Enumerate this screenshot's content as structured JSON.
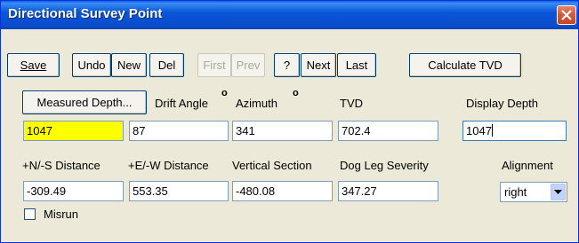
{
  "window": {
    "title": "Directional Survey Point"
  },
  "toolbar": {
    "save_label": "Save",
    "undo_label": "Undo",
    "new_label": "New",
    "del_label": "Del",
    "first_label": "First",
    "prev_label": "Prev",
    "help_label": "?",
    "next_label": "Next",
    "last_label": "Last",
    "calculate_tvd_label": "Calculate TVD"
  },
  "row1": {
    "measured_depth_button": "Measured Depth...",
    "drift_angle_label": "Drift Angle",
    "drift_angle_unit": "o",
    "azimuth_label": "Azimuth",
    "azimuth_unit": "o",
    "tvd_label": "TVD",
    "display_depth_label": "Display Depth",
    "measured_depth_value": "1047",
    "drift_angle_value": "87",
    "azimuth_value": "341",
    "tvd_value": "702.4",
    "display_depth_value": "1047"
  },
  "row2": {
    "ns_distance_label": "+N/-S Distance",
    "ew_distance_label": "+E/-W Distance",
    "vertical_section_label": "Vertical Section",
    "dog_leg_label": "Dog Leg Severity",
    "alignment_label": "Alignment",
    "ns_distance_value": "-309.49",
    "ew_distance_value": "553.35",
    "vertical_section_value": "-480.08",
    "dog_leg_value": "347.27",
    "alignment_value": "right"
  },
  "misrun": {
    "label": "Misrun",
    "checked": false
  },
  "colors": {
    "titlebar": "#0a4ccc",
    "window_bg": "#ece9d8",
    "highlight_field": "#ffff00",
    "close_button": "#d65a3a"
  }
}
